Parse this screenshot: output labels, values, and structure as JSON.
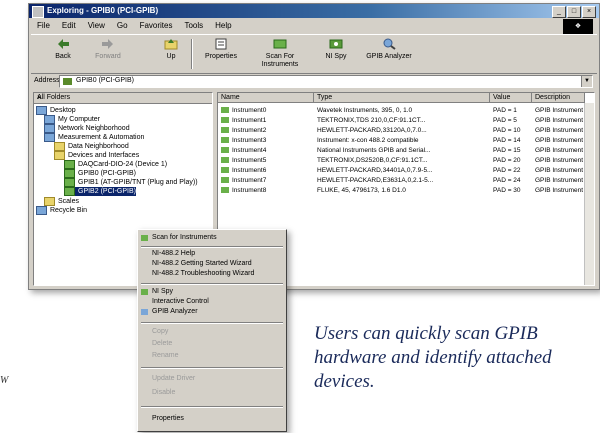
{
  "window": {
    "title": "Exploring - GPIB0 (PCI-GPIB)",
    "controls": [
      "_",
      "□",
      "×"
    ]
  },
  "menu": [
    "File",
    "Edit",
    "View",
    "Go",
    "Favorites",
    "Tools",
    "Help"
  ],
  "toolbar": {
    "back": "Back",
    "forward": "Forward",
    "up": "Up",
    "properties": "Properties",
    "scan": "Scan For Instruments",
    "nispy": "NI Spy",
    "gpib_analyzer": "GPIB Analyzer"
  },
  "address": {
    "label": "Address",
    "value": "GPIB0 (PCI-GPIB)"
  },
  "tree": {
    "header": "All Folders",
    "items": [
      "Desktop",
      "My Computer",
      "Network Neighborhood",
      "Measurement & Automation",
      "Data Neighborhood",
      "Devices and Interfaces",
      "DAQCard-DIO-24 (Device 1)",
      "GPIB0 (PCI-GPIB)",
      "GPIB1 (AT-GPIB/TNT (Plug and Play))",
      "GPIB2 (PCI-GPIB)",
      "Scales",
      "Recycle Bin"
    ],
    "selected_index": 9
  },
  "list": {
    "headers": [
      "Name",
      "Type",
      "Value",
      "Description"
    ],
    "rows": [
      [
        "Instrument0",
        "Wavetek Instruments, 395, 0, 1.0",
        "PAD = 1",
        "GPIB Instrument"
      ],
      [
        "Instrument1",
        "TEKTRONIX,TDS 210,0,CF:91.1CT...",
        "PAD = 5",
        "GPIB Instrument"
      ],
      [
        "Instrument2",
        "HEWLETT-PACKARD,33120A,0,7.0...",
        "PAD = 10",
        "GPIB Instrument"
      ],
      [
        "Instrument3",
        "Instrument: x-con 488.2 compatible",
        "PAD = 14",
        "GPIB Instrument"
      ],
      [
        "Instrument4",
        "National Instruments GPIB and Serial...",
        "PAD = 15",
        "GPIB Instrument"
      ],
      [
        "Instrument5",
        "TEKTRONIX,DS2520B,0,CF:91.1CT...",
        "PAD = 20",
        "GPIB Instrument"
      ],
      [
        "Instrument6",
        "HEWLETT-PACKARD,34401A,0,7.9-5...",
        "PAD = 22",
        "GPIB Instrument"
      ],
      [
        "Instrument7",
        "HEWLETT-PACKARD,E3631A,0,2.1-5...",
        "PAD = 24",
        "GPIB Instrument"
      ],
      [
        "Instrument8",
        "FLUKE, 45, 4796173, 1.6 D1.0",
        "PAD = 30",
        "GPIB Instrument"
      ]
    ]
  },
  "context_menu": {
    "items": [
      "Scan for Instruments",
      "NI-488.2 Help",
      "NI-488.2 Getting Started Wizard",
      "NI-488.2 Troubleshooting Wizard",
      "NI Spy",
      "Interactive Control",
      "GPIB Analyzer",
      "Copy",
      "Delete",
      "Rename",
      "Update Driver",
      "Disable",
      "Properties"
    ]
  },
  "caption": "Users can quickly scan GPIB hardware and identify attached devices.",
  "stray_text": "W"
}
